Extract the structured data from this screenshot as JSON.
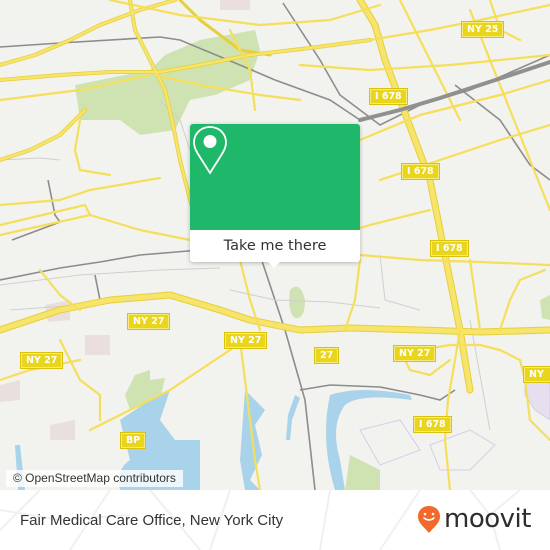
{
  "map": {
    "attribution": "© OpenStreetMap contributors",
    "colors": {
      "background": "#f2f2ef",
      "road": "#f7e46a",
      "road_casing": "#e6cf3a",
      "park": "#cfe3b2",
      "water": "#a9d3ea",
      "rail": "#8c8c8c"
    },
    "route_shields": [
      {
        "label": "NY 25"
      },
      {
        "label": "I 678"
      },
      {
        "label": "I 678"
      },
      {
        "label": "I 678"
      },
      {
        "label": "I 678"
      },
      {
        "label": "NY 27"
      },
      {
        "label": "NY 27"
      },
      {
        "label": "NY 27"
      },
      {
        "label": "27"
      },
      {
        "label": "NY 27"
      },
      {
        "label": "NY"
      },
      {
        "label": "BP"
      }
    ]
  },
  "popup": {
    "icon": "map-pin-icon",
    "button_label": "Take me there",
    "accent_color": "#1fb86a"
  },
  "footer": {
    "place_name": "Fair Medical Care Office, New York City",
    "brand": {
      "name": "moovit",
      "icon": "moovit-smiley-pin-icon",
      "color": "#f26a2b"
    }
  }
}
